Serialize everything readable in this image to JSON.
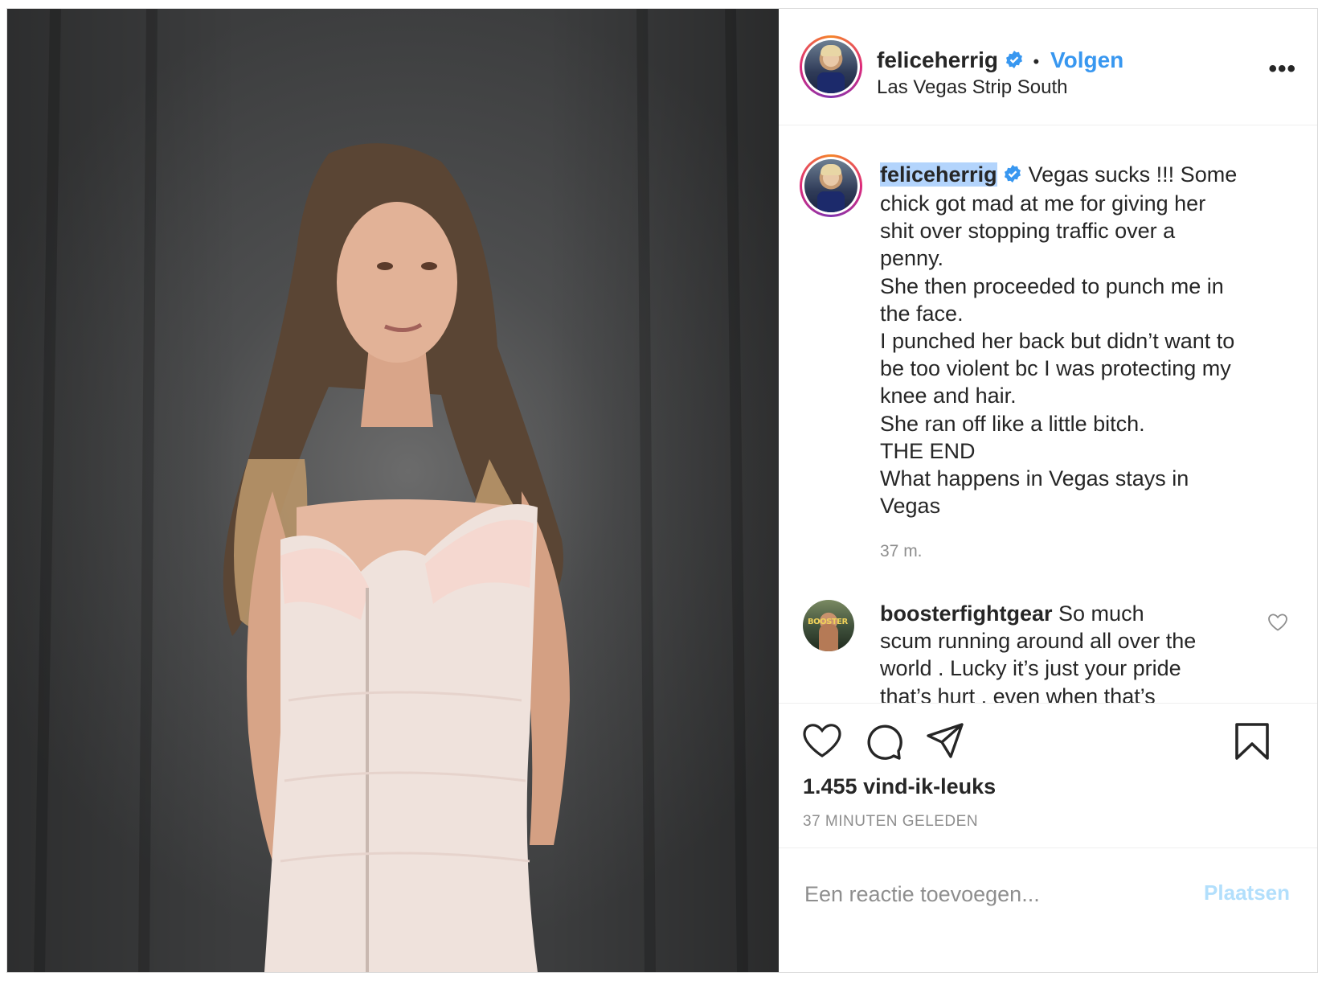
{
  "post": {
    "author": "feliceherrig",
    "separator": "•",
    "follow_label": "Volgen",
    "location": "Las Vegas Strip South",
    "more_label": "•••"
  },
  "caption": {
    "username": "feliceherrig",
    "lines": [
      "Vegas sucks !!! Some",
      "chick got mad at me for giving her",
      "shit over stopping traffic over a",
      "penny.",
      "She then proceeded to punch me in",
      "the face.",
      "I punched her back but didn’t want to",
      "be too violent bc I was protecting my",
      "knee and hair.",
      "She ran off like a little bitch.",
      "THE END",
      "What happens in Vegas stays in",
      "Vegas"
    ],
    "age": "37 m."
  },
  "comment": {
    "username": "boosterfightgear",
    "avatar_text": "BOOSTER",
    "lines": [
      "So much",
      "scum running around all over the",
      "world . Lucky it’s just your pride",
      "that’s hurt , even when that’s"
    ]
  },
  "stats": {
    "likes": "1.455 vind-ik-leuks",
    "timestamp": "37 MINUTEN GELEDEN"
  },
  "add_comment": {
    "placeholder": "Een reactie toevoegen...",
    "post_label": "Plaatsen"
  },
  "colors": {
    "accent_blue": "#3897f0",
    "disabled_blue": "#b2dffc",
    "muted_text": "#8e8e8e",
    "verified_blue": "#3897f0"
  },
  "icons": [
    "verified-badge-icon",
    "more-options-icon",
    "heart-icon",
    "comment-icon",
    "share-icon",
    "bookmark-icon",
    "small-heart-icon"
  ]
}
